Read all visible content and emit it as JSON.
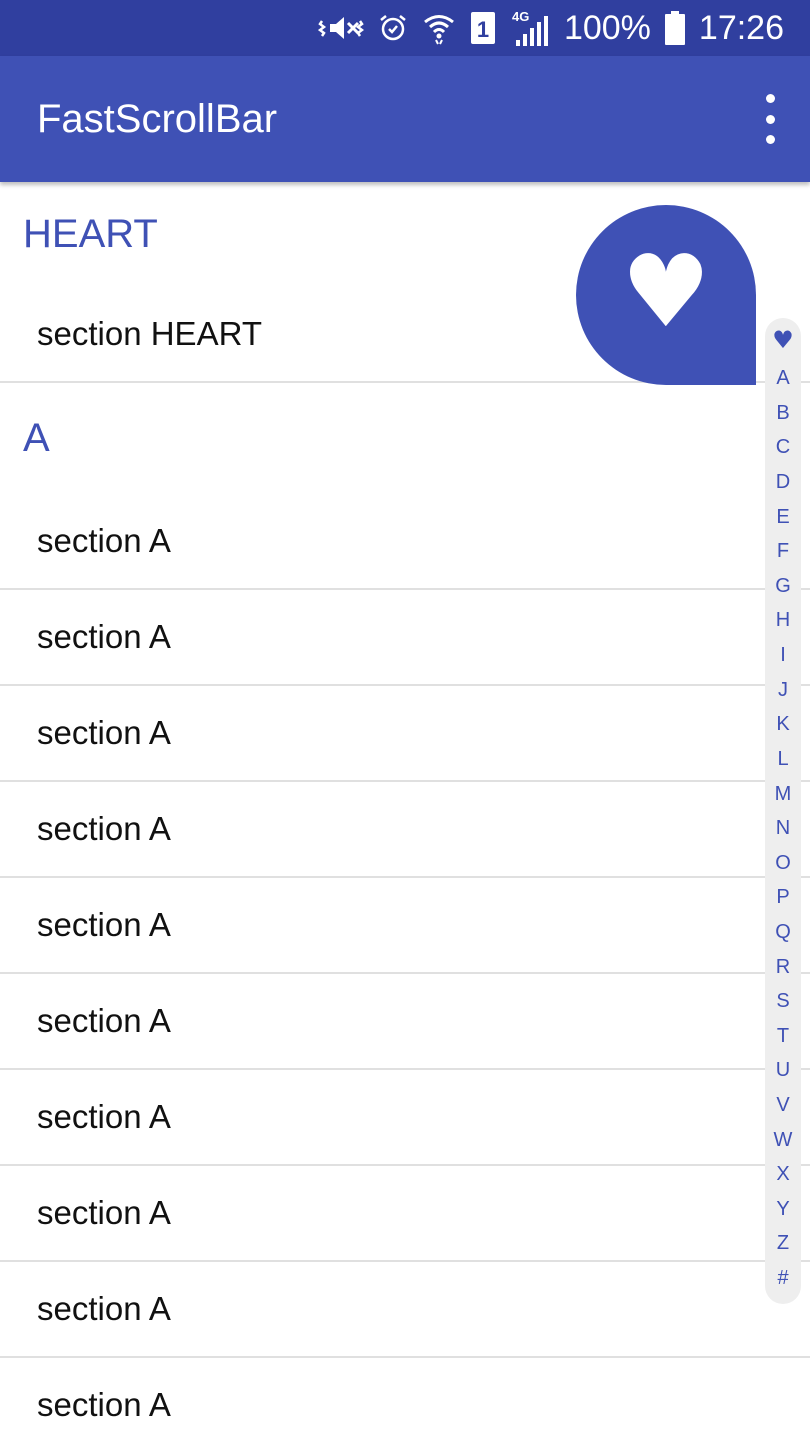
{
  "status_bar": {
    "battery_text": "100%",
    "time": "17:26",
    "network_label": "4G",
    "sim_number": "1",
    "icons": [
      "vibrate-mute-icon",
      "alarm-icon",
      "wifi-icon",
      "sim-icon",
      "signal-icon",
      "battery-icon"
    ]
  },
  "toolbar": {
    "title": "FastScrollBar",
    "overflow_icon": "more-vert-icon"
  },
  "list": {
    "sections": [
      {
        "header": "HEART",
        "items": [
          "section HEART"
        ]
      },
      {
        "header": "A",
        "items": [
          "section A",
          "section A",
          "section A",
          "section A",
          "section A",
          "section A",
          "section A",
          "section A",
          "section A",
          "section A"
        ]
      }
    ]
  },
  "bubble": {
    "glyph": "♥",
    "icon": "heart-icon"
  },
  "index_bar": {
    "letters": [
      "♥",
      "A",
      "B",
      "C",
      "D",
      "E",
      "F",
      "G",
      "H",
      "I",
      "J",
      "K",
      "L",
      "M",
      "N",
      "O",
      "P",
      "Q",
      "R",
      "S",
      "T",
      "U",
      "V",
      "W",
      "X",
      "Y",
      "Z",
      "#"
    ]
  },
  "colors": {
    "primary": "#3f51b5",
    "primary_dark": "#303f9f",
    "divider": "#e0e0e0",
    "index_bar_bg": "#eeeeee"
  }
}
